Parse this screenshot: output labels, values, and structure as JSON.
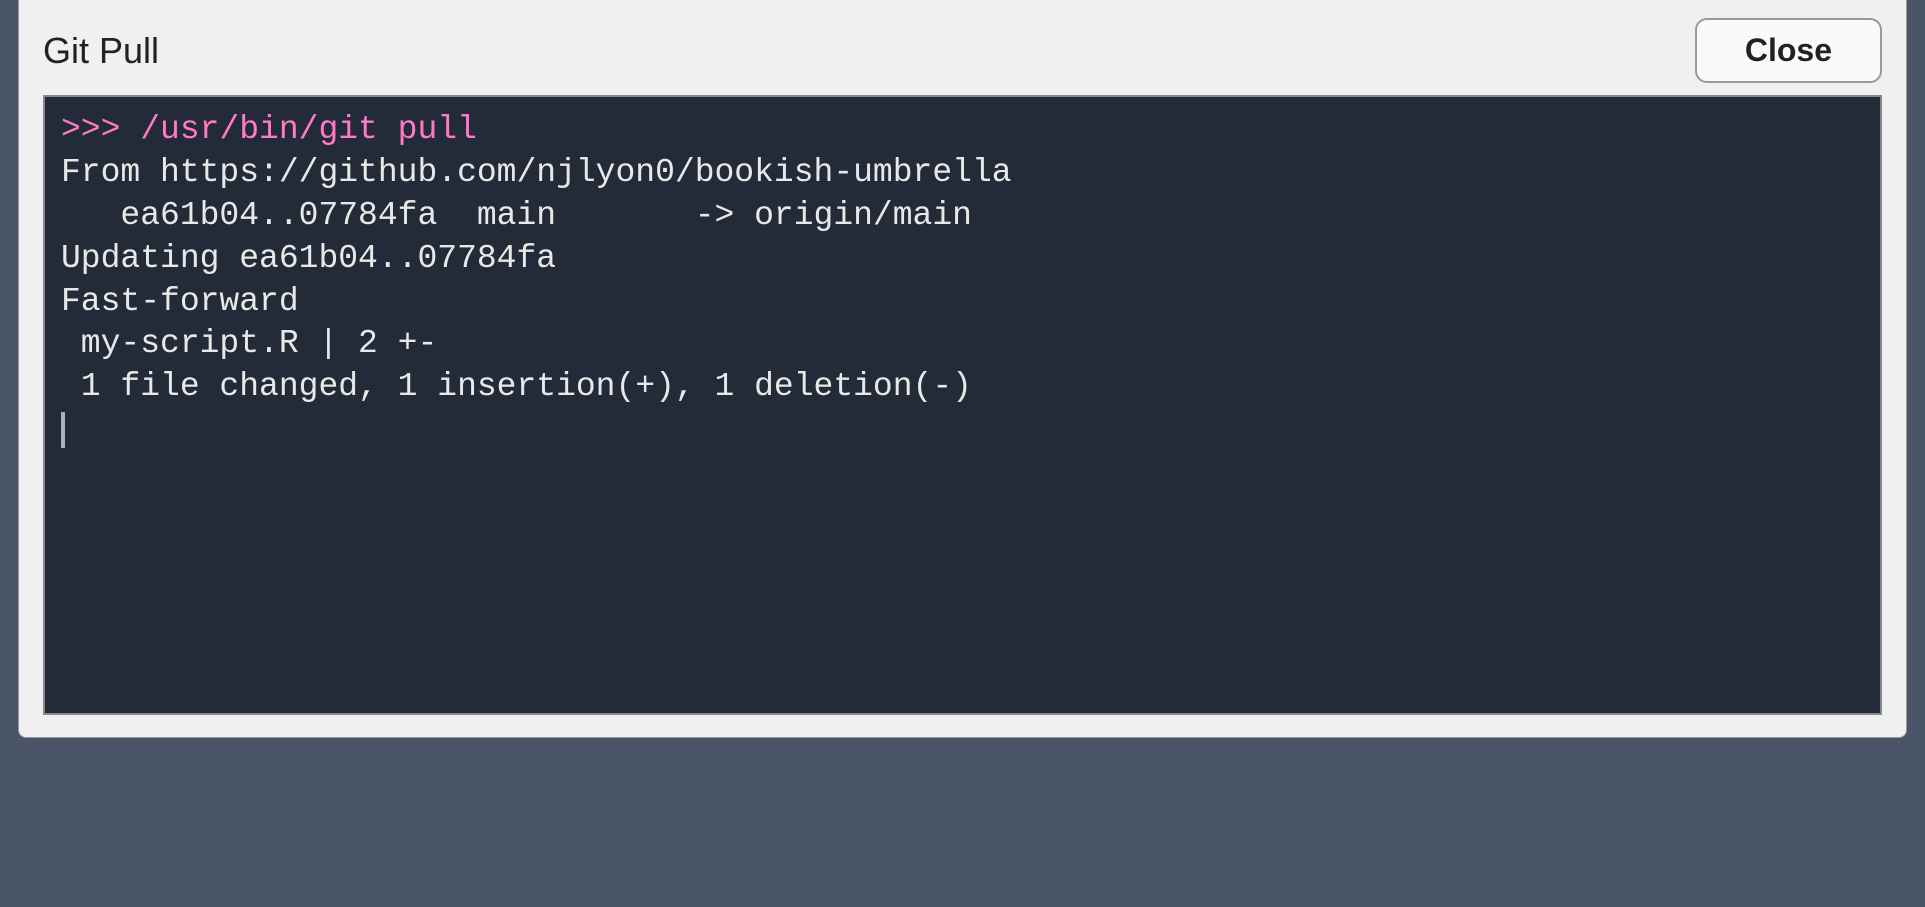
{
  "dialog": {
    "title": "Git Pull",
    "close_label": "Close"
  },
  "terminal": {
    "prompt_symbol": ">>> ",
    "command": "/usr/bin/git pull",
    "output_lines": [
      "From https://github.com/njlyon0/bookish-umbrella",
      "   ea61b04..07784fa  main       -> origin/main",
      "Updating ea61b04..07784fa",
      "Fast-forward",
      " my-script.R | 2 +-",
      " 1 file changed, 1 insertion(+), 1 deletion(-)"
    ]
  },
  "colors": {
    "terminal_bg": "#242b38",
    "terminal_fg": "#e8e8e8",
    "prompt_color": "#ff79c6",
    "dialog_bg": "#f0f0f0"
  }
}
